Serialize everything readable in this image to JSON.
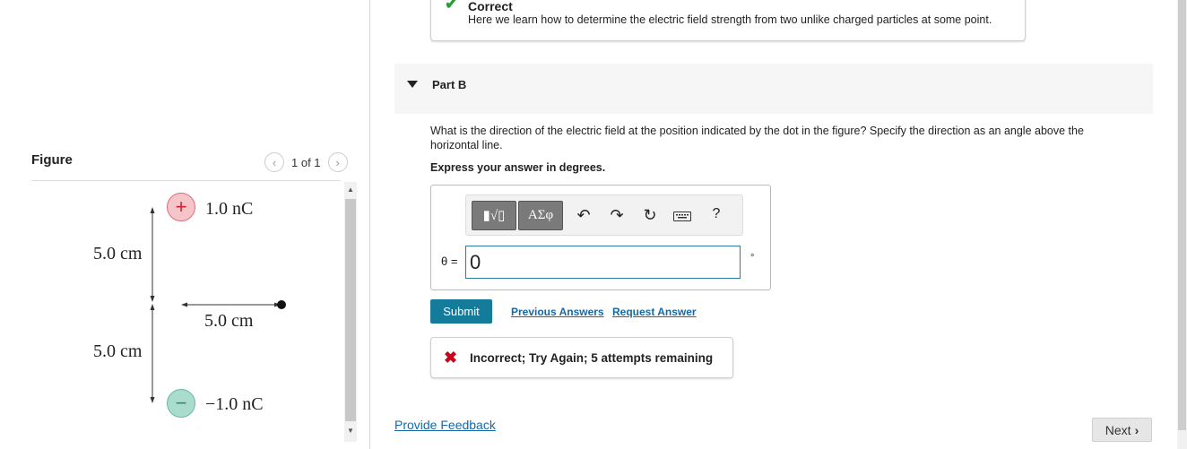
{
  "feedback": {
    "title": "Correct",
    "message": "Here we learn how to determine the electric field strength from two unlike charged particles at some point."
  },
  "part": {
    "label": "Part B",
    "question": "What is the direction of the electric field at the position indicated by the dot in the figure? Specify the direction as an angle above the horizontal line.",
    "instruction": "Express your answer in degrees."
  },
  "toolbar": {
    "templates_label": "▮√▯",
    "symbols_label": "ΑΣφ",
    "undo_icon": "undo-icon",
    "redo_icon": "redo-icon",
    "reset_icon": "reset-icon",
    "keyboard_icon": "keyboard-icon",
    "help_label": "?"
  },
  "answer": {
    "variable_label": "θ =",
    "value": "0",
    "unit": "°"
  },
  "actions": {
    "submit": "Submit",
    "previous_answers": "Previous Answers",
    "request_answer": "Request Answer"
  },
  "result": {
    "message": "Incorrect; Try Again; 5 attempts remaining"
  },
  "footer": {
    "provide_feedback": "Provide Feedback",
    "next": "Next"
  },
  "figure": {
    "title": "Figure",
    "pager": "1 of 1",
    "pos_charge_symbol": "+",
    "neg_charge_symbol": "−",
    "pos_charge_label": "1.0 nC",
    "neg_charge_label": "−1.0 nC",
    "top_distance": "5.0 cm",
    "bottom_distance": "5.0 cm",
    "horizontal_distance": "5.0 cm"
  },
  "colors": {
    "accent": "#147b9b",
    "link": "#1669a8",
    "correct": "#2a9d3a",
    "incorrect": "#d0021b"
  }
}
